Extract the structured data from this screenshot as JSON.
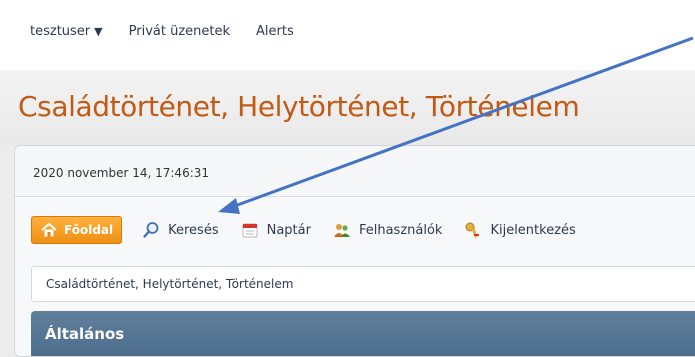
{
  "userbar": {
    "username": "tesztuser",
    "caret": "▼",
    "private_messages": "Privát üzenetek",
    "alerts": "Alerts"
  },
  "site": {
    "title": "Családtörténet, Helytörténet, Történelem"
  },
  "datetime": "2020 november 14, 17:46:31",
  "nav": {
    "home": "Főoldal",
    "search": "Keresés",
    "calendar": "Naptár",
    "members": "Felhasználók",
    "logout": "Kijelentkezés"
  },
  "breadcrumb": "Családtörténet, Helytörténet, Történelem",
  "category": "Általános",
  "colors": {
    "accent_title": "#c35a14",
    "home_button": "#f08f14",
    "category_bar": "#5a7a98",
    "arrow": "#4472c4"
  },
  "icons": {
    "home": "home-icon",
    "search": "magnifier-icon",
    "calendar": "calendar-icon",
    "members": "users-icon",
    "logout": "key-icon"
  }
}
